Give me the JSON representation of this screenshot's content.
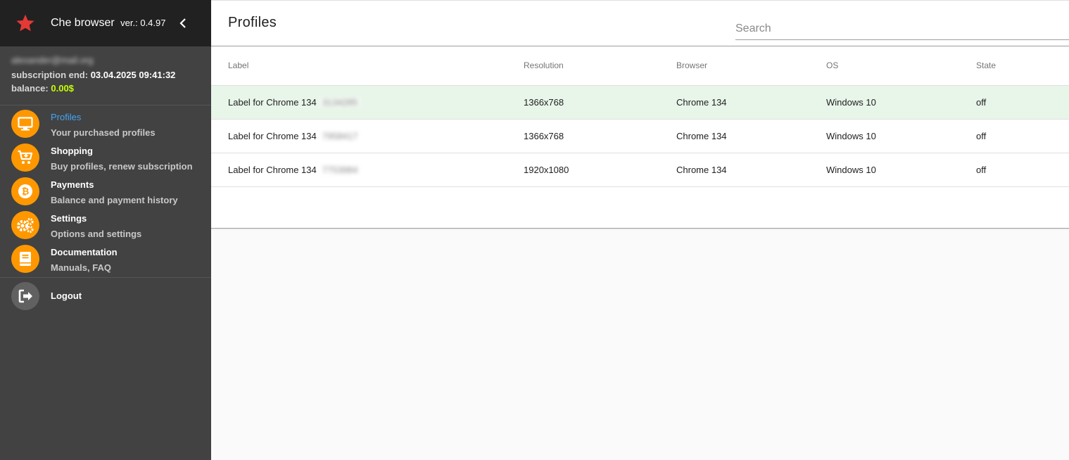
{
  "app": {
    "name": "Che browser",
    "version": "ver.: 0.4.97"
  },
  "account": {
    "email": "alexander@mail.org",
    "subscription_label": "subscription end:",
    "subscription_value": "03.04.2025 09:41:32",
    "balance_label": "balance:",
    "balance_value": "0.00$"
  },
  "menu": [
    {
      "title": "Profiles",
      "subtitle": "Your purchased profiles",
      "icon": "monitor-icon",
      "active": true
    },
    {
      "title": "Shopping",
      "subtitle": "Buy profiles, renew subscription",
      "icon": "cart-icon",
      "active": false
    },
    {
      "title": "Payments",
      "subtitle": "Balance and payment history",
      "icon": "bitcoin-icon",
      "active": false
    },
    {
      "title": "Settings",
      "subtitle": "Options and settings",
      "icon": "gears-icon",
      "active": false
    },
    {
      "title": "Documentation",
      "subtitle": "Manuals, FAQ",
      "icon": "book-icon",
      "active": false
    }
  ],
  "logout": {
    "title": "Logout",
    "icon": "logout-icon"
  },
  "page": {
    "title": "Profiles",
    "search_placeholder": "Search"
  },
  "table": {
    "columns": [
      "Label",
      "Resolution",
      "Browser",
      "OS",
      "State"
    ],
    "rows": [
      {
        "label": "Label for Chrome 134",
        "id": "3134285",
        "resolution": "1366x768",
        "browser": "Chrome 134",
        "os": "Windows 10",
        "state": "off",
        "selected": true
      },
      {
        "label": "Label for Chrome 134",
        "id": "7958417",
        "resolution": "1366x768",
        "browser": "Chrome 134",
        "os": "Windows 10",
        "state": "off",
        "selected": false
      },
      {
        "label": "Label for Chrome 134",
        "id": "7753984",
        "resolution": "1920x1080",
        "browser": "Chrome 134",
        "os": "Windows 10",
        "state": "off",
        "selected": false
      }
    ]
  },
  "colors": {
    "accent": "#ff9800",
    "active_link": "#42a5f5",
    "balance": "#c6ff00",
    "star": "#e53935",
    "selected_row": "#e8f5e9"
  }
}
